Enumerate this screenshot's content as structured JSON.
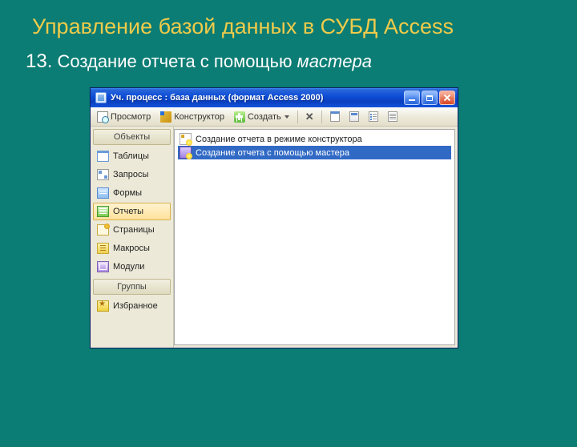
{
  "slide": {
    "title": "Управление базой данных в СУБД Access",
    "item_number": "13.",
    "subtitle_main": "Создание отчета с помощью ",
    "subtitle_italic": "мастера"
  },
  "window": {
    "title": "Уч. процесс : база данных (формат Access 2000)"
  },
  "toolbar": {
    "preview": "Просмотр",
    "design": "Конструктор",
    "create": "Создать"
  },
  "sidebar": {
    "objects_header": "Объекты",
    "items": [
      {
        "label": "Таблицы"
      },
      {
        "label": "Запросы"
      },
      {
        "label": "Формы"
      },
      {
        "label": "Отчеты"
      },
      {
        "label": "Страницы"
      },
      {
        "label": "Макросы"
      },
      {
        "label": "Модули"
      }
    ],
    "groups_header": "Группы",
    "favorites": "Избранное"
  },
  "list": {
    "items": [
      {
        "label": "Создание отчета в режиме конструктора"
      },
      {
        "label": "Создание отчета с помощью мастера"
      }
    ]
  }
}
